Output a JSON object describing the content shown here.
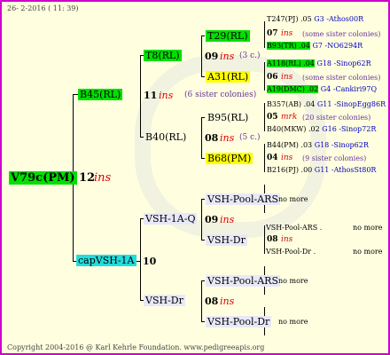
{
  "date": "26-  2-2016 ( 11: 39)",
  "footer": "Copyright 2004-2016 @ Karl Kehrle Foundation.  www.pedigreeapis.org",
  "root": {
    "name": "V79c(PM)",
    "num": "12",
    "ins": "ins"
  },
  "b45": {
    "name": "B45(RL)",
    "num": "11",
    "ins": "ins",
    "note": "(6 sister colonies)"
  },
  "cap": {
    "name": "capVSH-1A",
    "num": "10"
  },
  "t8": {
    "name": "T8(RL)",
    "num": "09",
    "ins": "ins",
    "note": "(3 c.)"
  },
  "b40": {
    "name": "B40(RL)",
    "num": "08",
    "ins": "ins",
    "note": "(5 c.)"
  },
  "t29": {
    "name": "T29(RL)"
  },
  "a31": {
    "name": "A31(RL)"
  },
  "b95": {
    "name": "B95(RL)"
  },
  "b68": {
    "name": "B68(PM)"
  },
  "g1": {
    "top": {
      "text": "T247(PJ) .05",
      "tail": "G3 -Athos00R"
    },
    "num": "07",
    "ins": "ins",
    "note": "(some sister colonies)",
    "bot": {
      "text": "B93(TR) .04",
      "tail": "G7 -NO6294R"
    }
  },
  "g2": {
    "top": {
      "text": "A118(RL) .04",
      "tail": "G18 -Sinop62R"
    },
    "num": "06",
    "ins": "ins",
    "note": "(some sister colonies)",
    "bot": {
      "text": "A19(DMC) .02",
      "tail": "G4 -Cankiri97Q"
    }
  },
  "g3": {
    "top": {
      "text": "B357(AB) .04",
      "tail": "G11 -SinopEgg86R"
    },
    "num": "05",
    "ins": "mrk",
    "note": "(20 sister colonies)",
    "bot": {
      "text": "B40(MKW) .02",
      "tail": "G16 -Sinop72R"
    }
  },
  "g4": {
    "top": {
      "text": "B44(PM) .03",
      "tail": "G18 -Sinop62R"
    },
    "num": "04",
    "ins": "ins",
    "note": "(9 sister colonies)",
    "bot": {
      "text": "B216(PJ) .00",
      "tail": "G11 -AthosSt80R"
    }
  },
  "vsh1aq": {
    "name": "VSH-1A-Q",
    "num": "09",
    "ins": "ins"
  },
  "vshdr1": {
    "name": "VSH-Dr",
    "num": "08",
    "ins": "ins"
  },
  "ars1": {
    "name": "VSH-Pool-ARS",
    "note": "no more"
  },
  "dr1": {
    "name": "VSH-Dr"
  },
  "ars2": {
    "name": "VSH-Pool-ARS .",
    "note": "no more"
  },
  "dr2": {
    "name": "VSH-Pool-Dr .",
    "note": "no more",
    "num": "08",
    "ins": "ins"
  },
  "ars3": {
    "name": "VSH-Pool-ARS",
    "note": "no more"
  },
  "dr3": {
    "name": "VSH-Pool-Dr",
    "note": "no more"
  }
}
